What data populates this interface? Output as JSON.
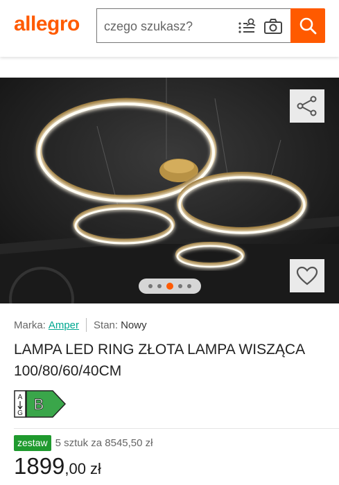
{
  "header": {
    "logo": "allegro",
    "search_placeholder": "czego szukasz?"
  },
  "gallery": {
    "dots_count": 5,
    "active_dot_index": 2
  },
  "meta": {
    "brand_label": "Marka:",
    "brand_value": "Amper",
    "condition_label": "Stan:",
    "condition_value": "Nowy"
  },
  "title": "LAMPA LED RING ZŁOTA LAMPA WISZĄCA 100/80/60/40CM",
  "energy": {
    "scale_top": "A",
    "scale_bottom": "G",
    "class": "B",
    "color": "#3aa64a"
  },
  "set": {
    "badge": "zestaw",
    "text": "5 sztuk za 8545,50 zł"
  },
  "price": {
    "integer": "1899",
    "decimals": ",00",
    "currency": "zł"
  },
  "colors": {
    "brand_orange": "#ff5a00",
    "link": "#00a790",
    "badge_green": "#1f9a2e"
  }
}
